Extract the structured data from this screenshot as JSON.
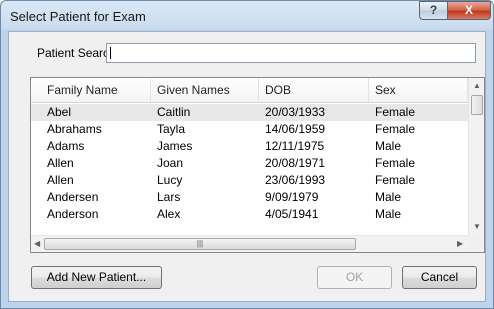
{
  "window": {
    "title": "Select Patient for Exam"
  },
  "titlebar": {
    "help_label": "?",
    "close_label": "X"
  },
  "search": {
    "label": "Patient Search",
    "value": ""
  },
  "table": {
    "columns": [
      "Family Name",
      "Given Names",
      "DOB",
      "Sex"
    ],
    "rows": [
      [
        "Abel",
        "Caitlin",
        "20/03/1933",
        "Female"
      ],
      [
        "Abrahams",
        "Tayla",
        "14/06/1959",
        "Female"
      ],
      [
        "Adams",
        "James",
        "12/11/1975",
        "Male"
      ],
      [
        "Allen",
        "Joan",
        "20/08/1971",
        "Female"
      ],
      [
        "Allen",
        "Lucy",
        "23/06/1993",
        "Female"
      ],
      [
        "Andersen",
        "Lars",
        "9/09/1979",
        "Male"
      ],
      [
        "Anderson",
        "Alex",
        "4/05/1941",
        "Male"
      ]
    ],
    "selected_row": 0
  },
  "buttons": {
    "add_new_patient": "Add New Patient...",
    "ok": "OK",
    "cancel": "Cancel"
  },
  "colors": {
    "selected_row": "#e8e8e8",
    "title_bar": "#c9dcee",
    "close_button": "#c2391f"
  },
  "icons": {
    "help": "help-icon",
    "close": "close-icon"
  }
}
